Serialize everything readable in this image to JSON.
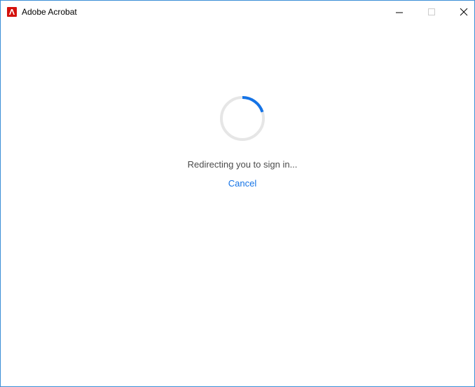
{
  "window": {
    "title": "Adobe Acrobat",
    "controls": {
      "minimize": "minimize-icon",
      "maximize": "maximize-icon",
      "close": "close-icon"
    }
  },
  "content": {
    "status_text": "Redirecting you to sign in...",
    "cancel_label": "Cancel"
  },
  "colors": {
    "brand_red": "#d4120d",
    "link_blue": "#1473e6",
    "spinner_blue": "#1473e6",
    "spinner_track": "#e6e6e6",
    "window_border": "#3b8fd6"
  }
}
